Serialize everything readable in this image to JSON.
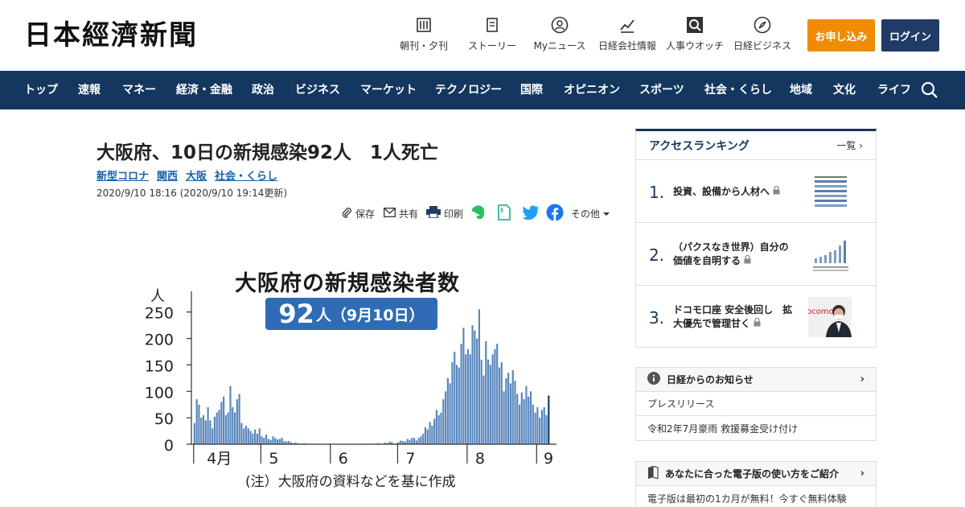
{
  "header": {
    "logo": "日本經濟新聞",
    "utils": [
      {
        "label": "朝刊・夕刊",
        "icon": "newspaper-icon"
      },
      {
        "label": "ストーリー",
        "icon": "story-icon"
      },
      {
        "label": "Myニュース",
        "icon": "user-icon"
      },
      {
        "label": "日経会社情報",
        "icon": "chart-line-icon"
      },
      {
        "label": "人事ウオッチ",
        "icon": "magnifier-icon"
      },
      {
        "label": "日経ビジネス",
        "icon": "compass-icon"
      }
    ],
    "apply_label": "お申し込み",
    "login_label": "ログイン"
  },
  "nav": {
    "items": [
      "トップ",
      "速報",
      "マネー",
      "経済・金融",
      "政治",
      "ビジネス",
      "マーケット",
      "テクノロジー",
      "国際",
      "オピニオン",
      "スポーツ",
      "社会・くらし",
      "地域",
      "文化",
      "ライフ"
    ]
  },
  "article": {
    "title": "大阪府、10日の新規感染92人　1人死亡",
    "tags": [
      "新型コロナ",
      "関西",
      "大阪",
      "社会・くらし"
    ],
    "date": "2020/9/10 18:16 (2020/9/10 19:14更新)",
    "share": {
      "save": "保存",
      "share": "共有",
      "print": "印刷",
      "other": "その他"
    }
  },
  "chart_data": {
    "type": "bar",
    "title": "大阪府の新規感染者数",
    "badge_value": "92",
    "badge_suffix": "人（9月10日）",
    "ylabel": "人",
    "ylim": [
      0,
      280
    ],
    "yticks": [
      "250",
      "200",
      "150",
      "100",
      "50",
      "0"
    ],
    "yvalues": [
      250,
      200,
      150,
      100,
      50,
      0
    ],
    "month_labels": [
      "4月",
      "5",
      "6",
      "7",
      "8",
      "9"
    ],
    "month_days": [
      1,
      31,
      62,
      92,
      123,
      154
    ],
    "start_date": "2020-03-31",
    "values": [
      0,
      40,
      85,
      75,
      50,
      55,
      45,
      70,
      45,
      30,
      52,
      60,
      65,
      80,
      90,
      55,
      60,
      110,
      70,
      60,
      85,
      95,
      40,
      30,
      35,
      30,
      25,
      20,
      28,
      20,
      30,
      15,
      12,
      18,
      10,
      8,
      15,
      12,
      9,
      10,
      12,
      6,
      5,
      6,
      4,
      2,
      3,
      2,
      1,
      1,
      2,
      1,
      1,
      0,
      1,
      0,
      0,
      0,
      0,
      0,
      0,
      1,
      0,
      0,
      0,
      0,
      0,
      0,
      0,
      0,
      0,
      0,
      0,
      0,
      0,
      0,
      0,
      0,
      1,
      0,
      0,
      1,
      1,
      2,
      0,
      1,
      3,
      2,
      5,
      4,
      1,
      2,
      4,
      7,
      6,
      5,
      10,
      8,
      12,
      12,
      7,
      12,
      15,
      20,
      32,
      28,
      42,
      35,
      48,
      65,
      55,
      60,
      85,
      100,
      125,
      115,
      155,
      175,
      150,
      145,
      190,
      220,
      170,
      180,
      170,
      225,
      215,
      200,
      255,
      160,
      130,
      195,
      160,
      150,
      170,
      180,
      190,
      145,
      155,
      100,
      125,
      135,
      115,
      140,
      120,
      95,
      75,
      98,
      85,
      110,
      90,
      100,
      75,
      60,
      70,
      50,
      65,
      70,
      55,
      92
    ],
    "note": "(注）大阪府の資料などを基に作成",
    "bar_color": "#5a87bd",
    "last_bar_color": "#163a6b"
  },
  "sidebar": {
    "ranking": {
      "title": "アクセスランキング",
      "more": "一覧",
      "items": [
        {
          "rank": "1.",
          "text": "投資、設備から人材へ"
        },
        {
          "rank": "2.",
          "text": "（パクスなき世界）自分の価値を自明する"
        },
        {
          "rank": "3.",
          "text": "ドコモ口座 安全後回し　拡大優先で管理甘く"
        }
      ],
      "thumb3_text": "ocomo"
    },
    "notice": {
      "title": "日経からのお知らせ",
      "items": [
        "プレスリリース",
        "令和2年7月豪雨 救援募金受け付け"
      ]
    },
    "digital": {
      "title": "あなたに合った電子版の使い方をご紹介",
      "items": [
        "電子版は最初の1カ月が無料！今すぐ無料体験"
      ]
    }
  },
  "colors": {
    "nav_bg": "#14375f",
    "apply_btn": "#f08c00",
    "login_btn": "#1f3b66",
    "tag_link": "#1a5fa6",
    "badge_bg": "#2f6cb5"
  }
}
